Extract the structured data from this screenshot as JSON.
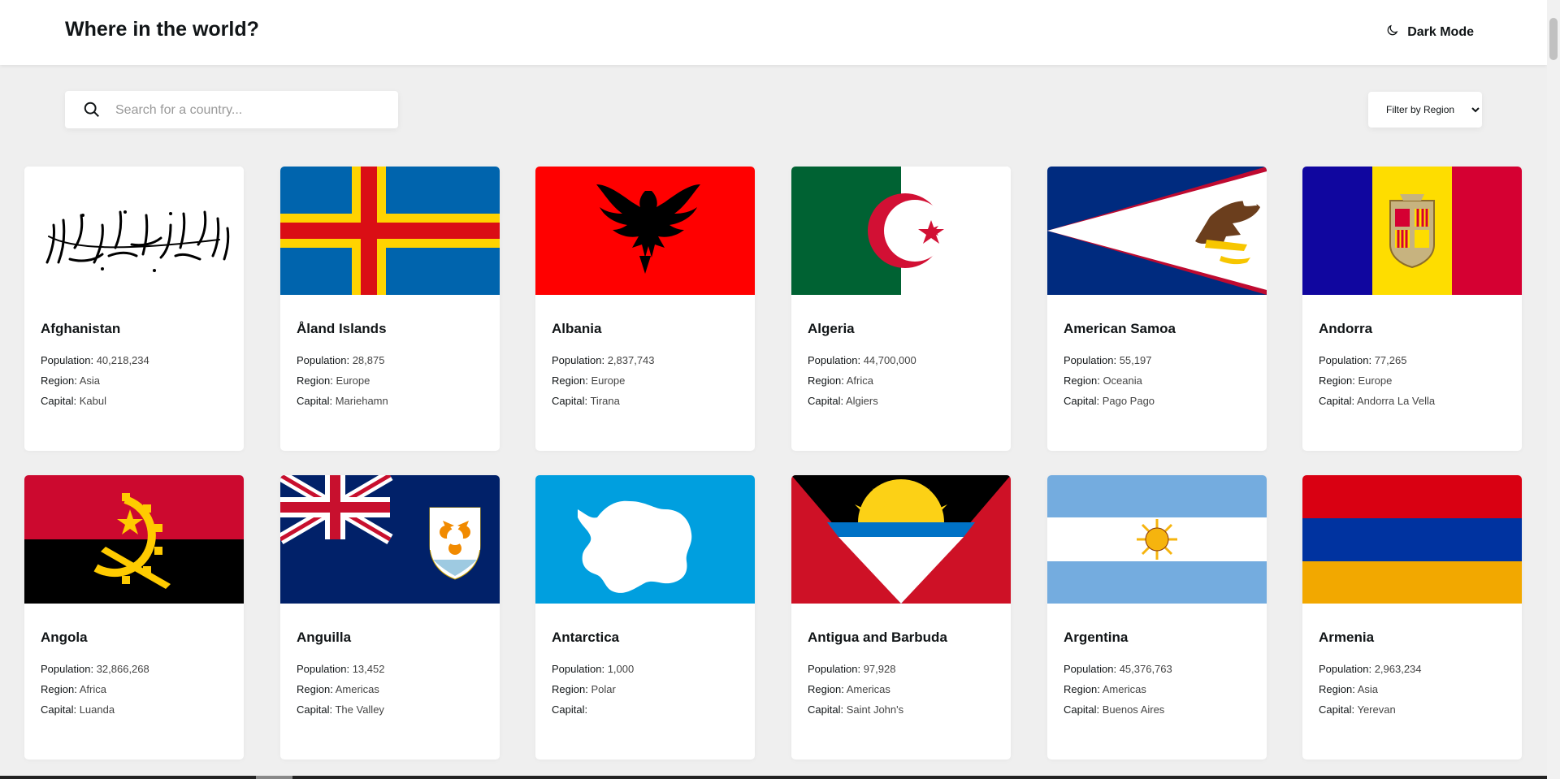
{
  "header": {
    "title": "Where in the world?",
    "theme_label": "Dark Mode",
    "theme_icon": "moon-icon"
  },
  "search": {
    "placeholder": "Search for a country...",
    "value": "",
    "icon": "search-icon"
  },
  "filter": {
    "selected": "Filter by Region"
  },
  "countries": [
    {
      "name": "Afghanistan",
      "population": "40,218,234",
      "region": "Asia",
      "capital": "Kabul"
    },
    {
      "name": "Åland Islands",
      "population": "28,875",
      "region": "Europe",
      "capital": "Mariehamn"
    },
    {
      "name": "Albania",
      "population": "2,837,743",
      "region": "Europe",
      "capital": "Tirana"
    },
    {
      "name": "Algeria",
      "population": "44,700,000",
      "region": "Africa",
      "capital": "Algiers"
    },
    {
      "name": "American Samoa",
      "population": "55,197",
      "region": "Oceania",
      "capital": "Pago Pago"
    },
    {
      "name": "Andorra",
      "population": "77,265",
      "region": "Europe",
      "capital": "Andorra La Vella"
    },
    {
      "name": "Angola",
      "population": "32,866,268",
      "region": "Africa",
      "capital": "Luanda"
    },
    {
      "name": "Anguilla",
      "population": "13,452",
      "region": "Americas",
      "capital": "The Valley"
    },
    {
      "name": "Antarctica",
      "population": "1,000",
      "region": "Polar",
      "capital": ""
    },
    {
      "name": "Antigua and Barbuda",
      "population": "97,928",
      "region": "Americas",
      "capital": "Saint John's"
    },
    {
      "name": "Argentina",
      "population": "45,376,763",
      "region": "Americas",
      "capital": "Buenos Aires"
    },
    {
      "name": "Armenia",
      "population": "2,963,234",
      "region": "Asia",
      "capital": "Yerevan"
    }
  ],
  "labels": {
    "population": "Population:",
    "region": "Region:",
    "capital": "Capital:"
  }
}
